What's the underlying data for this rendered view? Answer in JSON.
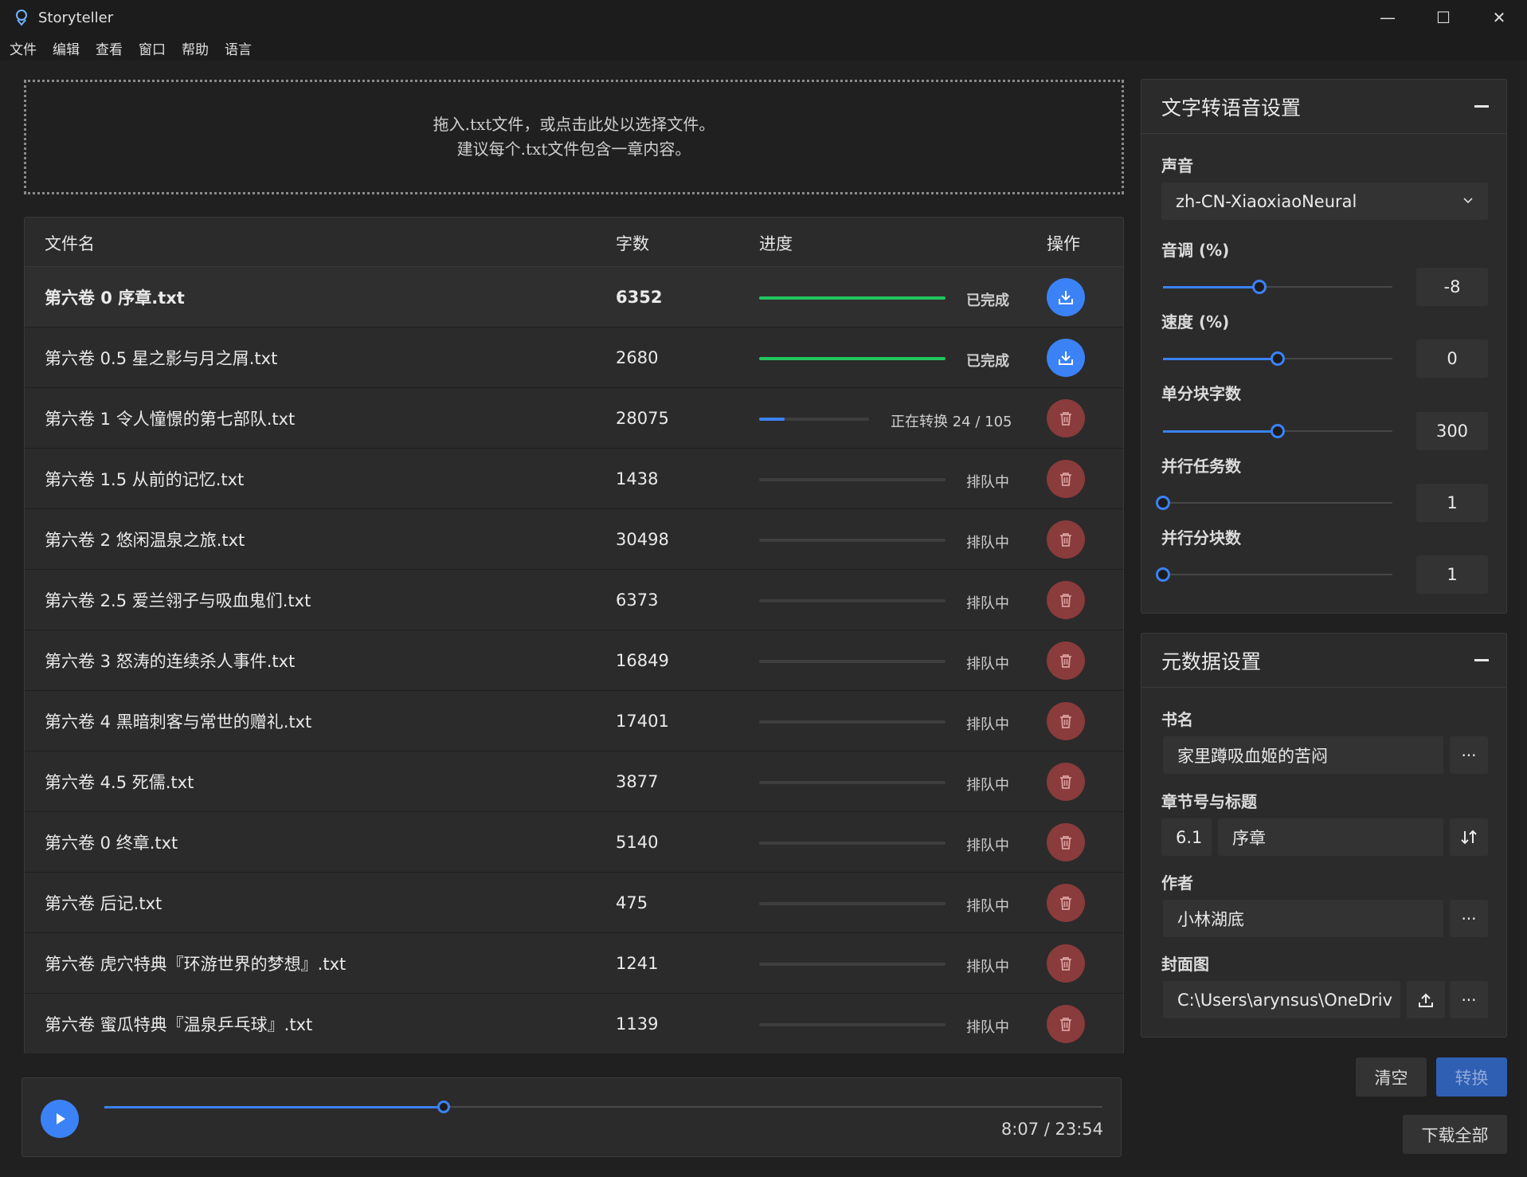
{
  "window": {
    "title": "Storyteller",
    "minimize": "—",
    "maximize": "☐",
    "close": "✕"
  },
  "menu": [
    "文件",
    "编辑",
    "查看",
    "窗口",
    "帮助",
    "语言"
  ],
  "dropzone": {
    "line1": "拖入.txt文件，或点击此处以选择文件。",
    "line2": "建议每个.txt文件包含一章内容。"
  },
  "table": {
    "headers": {
      "name": "文件名",
      "count": "字数",
      "progress": "进度",
      "action": "操作"
    },
    "rows": [
      {
        "name": "第六卷 0 序章.txt",
        "count": "6352",
        "status": "已完成",
        "progress": 1.0,
        "state": "done"
      },
      {
        "name": "第六卷 0.5 星之影与月之屑.txt",
        "count": "2680",
        "status": "已完成",
        "progress": 1.0,
        "state": "done"
      },
      {
        "name": "第六卷 1 令人憧憬的第七部队.txt",
        "count": "28075",
        "status": "正在转换 24 / 105",
        "progress": 0.23,
        "state": "converting"
      },
      {
        "name": "第六卷 1.5 从前的记忆.txt",
        "count": "1438",
        "status": "排队中",
        "progress": 0,
        "state": "queued"
      },
      {
        "name": "第六卷 2 悠闲温泉之旅.txt",
        "count": "30498",
        "status": "排队中",
        "progress": 0,
        "state": "queued"
      },
      {
        "name": "第六卷 2.5 爱兰翎子与吸血鬼们.txt",
        "count": "6373",
        "status": "排队中",
        "progress": 0,
        "state": "queued"
      },
      {
        "name": "第六卷 3 怒涛的连续杀人事件.txt",
        "count": "16849",
        "status": "排队中",
        "progress": 0,
        "state": "queued"
      },
      {
        "name": "第六卷 4 黑暗刺客与常世的赠礼.txt",
        "count": "17401",
        "status": "排队中",
        "progress": 0,
        "state": "queued"
      },
      {
        "name": "第六卷 4.5 死儒.txt",
        "count": "3877",
        "status": "排队中",
        "progress": 0,
        "state": "queued"
      },
      {
        "name": "第六卷 0 终章.txt",
        "count": "5140",
        "status": "排队中",
        "progress": 0,
        "state": "queued"
      },
      {
        "name": "第六卷 后记.txt",
        "count": "475",
        "status": "排队中",
        "progress": 0,
        "state": "queued"
      },
      {
        "name": "第六卷 虎穴特典『环游世界的梦想』.txt",
        "count": "1241",
        "status": "排队中",
        "progress": 0,
        "state": "queued"
      },
      {
        "name": "第六卷 蜜瓜特典『温泉乒乓球』.txt",
        "count": "1139",
        "status": "排队中",
        "progress": 0,
        "state": "queued"
      }
    ]
  },
  "player": {
    "time": "8:07 / 23:54",
    "position": 0.34
  },
  "tts": {
    "title": "文字转语音设置",
    "voice_label": "声音",
    "voice_value": "zh-CN-XiaoxiaoNeural",
    "pitch_label": "音调 (%)",
    "pitch_value": "-8",
    "pitch_pos": 0.42,
    "speed_label": "速度 (%)",
    "speed_value": "0",
    "speed_pos": 0.5,
    "chunk_label": "单分块字数",
    "chunk_value": "300",
    "chunk_pos": 0.5,
    "tasks_label": "并行任务数",
    "tasks_value": "1",
    "tasks_pos": 0.0,
    "chunks_label": "并行分块数",
    "chunks_value": "1",
    "chunks_pos": 0.0
  },
  "meta": {
    "title": "元数据设置",
    "book_label": "书名",
    "book_value": "家里蹲吸血姬的苦闷",
    "chapter_label": "章节号与标题",
    "chapter_num": "6.1",
    "chapter_title": "序章",
    "author_label": "作者",
    "author_value": "小林湖底",
    "cover_label": "封面图",
    "cover_value": "C:\\Users\\arynsus\\OneDriv",
    "more": "···"
  },
  "buttons": {
    "clear": "清空",
    "convert": "转换",
    "download_all": "下载全部"
  },
  "colors": {
    "accent": "#3b82f6",
    "done": "#22c55e",
    "delete": "#8a3b3b"
  }
}
